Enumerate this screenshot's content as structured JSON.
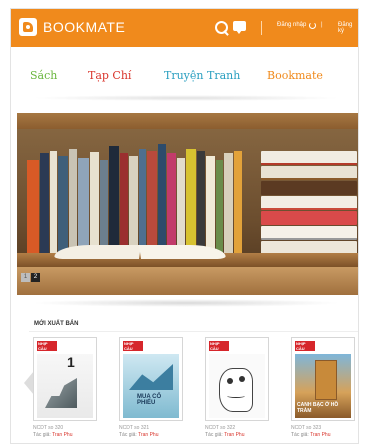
{
  "header": {
    "app_name": "BOOKMATE",
    "login_label": "Đăng nhập",
    "separator": "|",
    "register_label": "Đăng ký",
    "accent": "#f08a1c"
  },
  "nav": {
    "items": [
      {
        "label": "Sách",
        "color": "#6ab63e"
      },
      {
        "label": "Tạp Chí",
        "color": "#d9352c"
      },
      {
        "label": "Truyện Tranh",
        "color": "#2a9fc0"
      },
      {
        "label": "Bookmate",
        "color": "#f08a1c"
      }
    ]
  },
  "banner": {
    "slide_prev": "1",
    "slide_current": "2"
  },
  "releases": {
    "title": "MỚI XUẤT BẢN",
    "items": [
      {
        "meta": "NCDT so 320",
        "author_label": "Tác giả:",
        "author": "Tran Phu",
        "headline": "1"
      },
      {
        "meta": "NCDT so 321",
        "author_label": "Tác giả:",
        "author": "Tran Phu",
        "headline": "MUA CỔ PHIẾU"
      },
      {
        "meta": "NCDT so 322",
        "author_label": "Tác giả:",
        "author": "Tran Phu",
        "headline": ""
      },
      {
        "meta": "NCDT so 323",
        "author_label": "Tác giả:",
        "author": "Tran Phu",
        "headline": "CANH BẠC Ở HỒ TRÀM"
      }
    ]
  }
}
